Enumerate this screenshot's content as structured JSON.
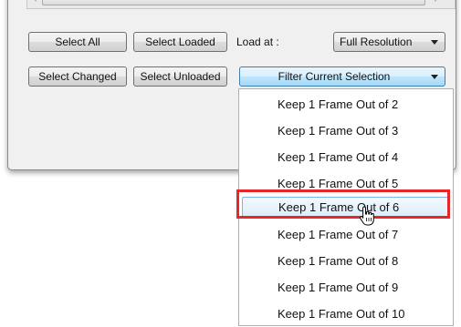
{
  "scrollbar": {
    "left_arrow": "‹",
    "right_arrow": "›",
    "grip": "⫶"
  },
  "buttons": {
    "select_all": "Select All",
    "select_loaded": "Select Loaded",
    "select_changed": "Select Changed",
    "select_unloaded": "Select Unloaded"
  },
  "load_at": {
    "label": "Load at :",
    "value": "Full Resolution"
  },
  "filter": {
    "value": "Filter Current Selection",
    "options": [
      "Keep 1 Frame Out of 2",
      "Keep 1 Frame Out of 3",
      "Keep 1 Frame Out of 4",
      "Keep 1 Frame Out of 5",
      "Keep 1 Frame Out of 6",
      "Keep 1 Frame Out of 7",
      "Keep 1 Frame Out of 8",
      "Keep 1 Frame Out of 9",
      "Keep 1 Frame Out of 10"
    ],
    "hovered_index": 4
  },
  "colors": {
    "highlight_border": "#e8262a",
    "hover_fill": "#dcecfa",
    "active_combo": "#bee6fd"
  }
}
